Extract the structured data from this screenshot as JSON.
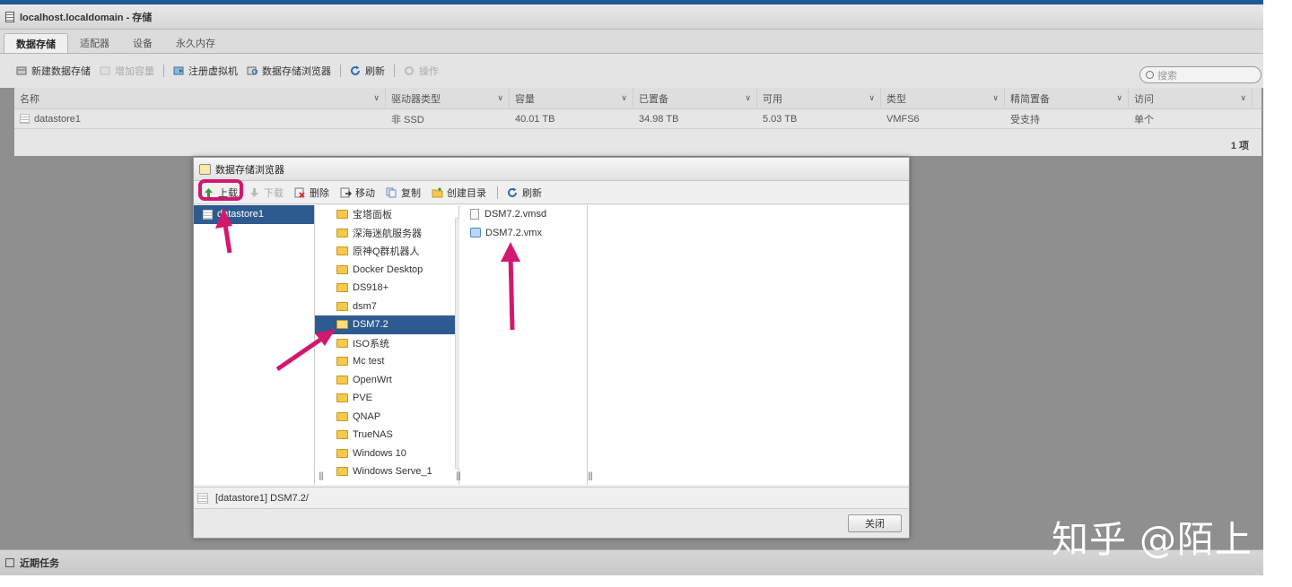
{
  "window": {
    "title": "localhost.localdomain - 存储"
  },
  "tabs": [
    {
      "label": "数据存储"
    },
    {
      "label": "适配器"
    },
    {
      "label": "设备"
    },
    {
      "label": "永久内存"
    }
  ],
  "toolbar": {
    "new_datastore": "新建数据存储",
    "increase_capacity": "增加容量",
    "register_vm": "注册虚拟机",
    "datastore_browser": "数据存储浏览器",
    "refresh": "刷新",
    "actions": "操作",
    "search_placeholder": "搜索"
  },
  "grid": {
    "columns": [
      "名称",
      "驱动器类型",
      "容量",
      "已置备",
      "可用",
      "类型",
      "精简置备",
      "访问"
    ],
    "rows": [
      [
        "datastore1",
        "非 SSD",
        "40.01 TB",
        "34.98 TB",
        "5.03 TB",
        "VMFS6",
        "受支持",
        "单个"
      ]
    ],
    "count": "1 项"
  },
  "dialog": {
    "title": "数据存储浏览器",
    "toolbar": {
      "upload": "上载",
      "download": "下载",
      "delete": "删除",
      "move": "移动",
      "copy": "复制",
      "create_dir": "创建目录",
      "refresh": "刷新"
    },
    "datastores": [
      "datastore1"
    ],
    "folders": [
      "宝塔面板",
      "深海迷航服务器",
      "原神Q群机器人",
      "Docker Desktop",
      "DS918+",
      "dsm7",
      "DSM7.2",
      "ISO系统",
      "Mc test",
      "OpenWrt",
      "PVE",
      "QNAP",
      "TrueNAS",
      "Windows 10",
      "Windows Serve_1"
    ],
    "selected_folder": "DSM7.2",
    "files": [
      "DSM7.2.vmsd",
      "DSM7.2.vmx"
    ],
    "path": "[datastore1] DSM7.2/",
    "close": "关闭"
  },
  "recent_tasks": {
    "label": "近期任务"
  },
  "watermark": "知乎 @陌上",
  "colors": {
    "accent": "#2e5b8f",
    "annotation": "#d2186e"
  }
}
